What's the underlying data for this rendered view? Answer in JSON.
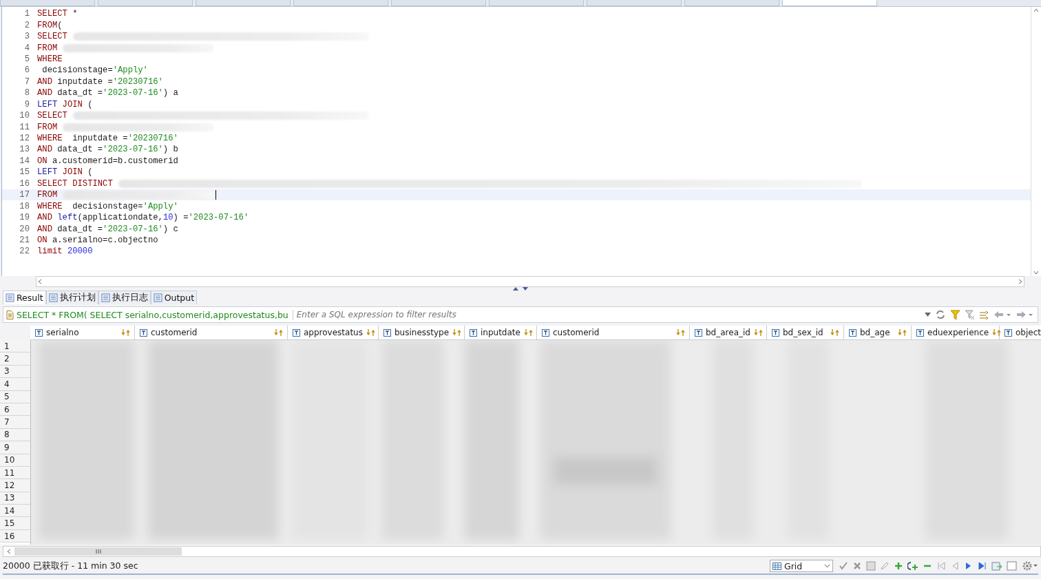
{
  "editor_tabs": [
    {
      "selected": false
    },
    {
      "selected": false
    },
    {
      "selected": false
    },
    {
      "selected": false
    },
    {
      "selected": false
    },
    {
      "selected": false
    },
    {
      "selected": false
    },
    {
      "selected": false
    },
    {
      "selected": true
    }
  ],
  "editor": {
    "lines": [
      {
        "number": "1",
        "current": false,
        "tokens": [
          {
            "kind": "kw",
            "text": "SELECT"
          },
          {
            "kind": "plain",
            "text": " *"
          }
        ]
      },
      {
        "number": "2",
        "current": false,
        "tokens": [
          {
            "kind": "kw",
            "text": "FROM"
          },
          {
            "kind": "plain",
            "text": "("
          }
        ]
      },
      {
        "number": "3",
        "current": false,
        "tokens": [
          {
            "kind": "kw",
            "text": "SELECT"
          }
        ],
        "kind": "masklong"
      },
      {
        "number": "4",
        "current": false,
        "tokens": [
          {
            "kind": "kw",
            "text": "FROM"
          }
        ],
        "kind": "maskshort"
      },
      {
        "number": "5",
        "current": false,
        "tokens": [
          {
            "kind": "kw",
            "text": "WHERE"
          }
        ]
      },
      {
        "number": "6",
        "current": false,
        "tokens": [
          {
            "kind": "plain",
            "text": " decisionstage="
          },
          {
            "kind": "str",
            "text": "'Apply'"
          }
        ]
      },
      {
        "number": "7",
        "current": false,
        "tokens": [
          {
            "kind": "kw",
            "text": "AND"
          },
          {
            "kind": "plain",
            "text": " inputdate ="
          },
          {
            "kind": "str",
            "text": "'20230716'"
          }
        ]
      },
      {
        "number": "8",
        "current": false,
        "tokens": [
          {
            "kind": "kw",
            "text": "AND"
          },
          {
            "kind": "plain",
            "text": " data_dt ="
          },
          {
            "kind": "str",
            "text": "'2023-07-16'"
          },
          {
            "kind": "plain",
            "text": ") a"
          }
        ]
      },
      {
        "number": "9",
        "current": false,
        "tokens": [
          {
            "kind": "fn",
            "text": "LEFT"
          },
          {
            "kind": "kw",
            "text": " JOIN"
          },
          {
            "kind": "plain",
            "text": " ("
          }
        ]
      },
      {
        "number": "10",
        "current": false,
        "tokens": [
          {
            "kind": "kw",
            "text": "SELECT"
          }
        ],
        "kind": "masklong"
      },
      {
        "number": "11",
        "current": false,
        "tokens": [
          {
            "kind": "kw",
            "text": "FROM"
          }
        ],
        "kind": "maskshort"
      },
      {
        "number": "12",
        "current": false,
        "tokens": [
          {
            "kind": "kw",
            "text": "WHERE"
          },
          {
            "kind": "plain",
            "text": "  inputdate ="
          },
          {
            "kind": "str",
            "text": "'20230716'"
          }
        ]
      },
      {
        "number": "13",
        "current": false,
        "tokens": [
          {
            "kind": "kw",
            "text": "AND"
          },
          {
            "kind": "plain",
            "text": " data_dt ="
          },
          {
            "kind": "str",
            "text": "'2023-07-16'"
          },
          {
            "kind": "plain",
            "text": ") b"
          }
        ]
      },
      {
        "number": "14",
        "current": false,
        "tokens": [
          {
            "kind": "kw",
            "text": "ON"
          },
          {
            "kind": "plain",
            "text": " a.customerid=b.customerid"
          }
        ]
      },
      {
        "number": "15",
        "current": false,
        "tokens": [
          {
            "kind": "fn",
            "text": "LEFT"
          },
          {
            "kind": "kw",
            "text": " JOIN"
          },
          {
            "kind": "plain",
            "text": " ("
          }
        ]
      },
      {
        "number": "16",
        "current": false,
        "tokens": [
          {
            "kind": "kw",
            "text": "SELECT DISTINCT"
          }
        ],
        "kind": "maskwide"
      },
      {
        "number": "17",
        "current": true,
        "tokens": [
          {
            "kind": "kw",
            "text": "FROM"
          }
        ],
        "kind": "maskshort"
      },
      {
        "number": "18",
        "current": false,
        "tokens": [
          {
            "kind": "kw",
            "text": "WHERE"
          },
          {
            "kind": "plain",
            "text": "  decisionstage="
          },
          {
            "kind": "str",
            "text": "'Apply'"
          }
        ]
      },
      {
        "number": "19",
        "current": false,
        "tokens": [
          {
            "kind": "kw",
            "text": "AND"
          },
          {
            "kind": "fn",
            "text": " left"
          },
          {
            "kind": "plain",
            "text": "(applicationdate,"
          },
          {
            "kind": "num",
            "text": "10"
          },
          {
            "kind": "plain",
            "text": ") ="
          },
          {
            "kind": "str",
            "text": "'2023-07-16'"
          }
        ]
      },
      {
        "number": "20",
        "current": false,
        "tokens": [
          {
            "kind": "kw",
            "text": "AND"
          },
          {
            "kind": "plain",
            "text": " data_dt ="
          },
          {
            "kind": "str",
            "text": "'2023-07-16'"
          },
          {
            "kind": "plain",
            "text": ") c"
          }
        ]
      },
      {
        "number": "21",
        "current": false,
        "tokens": [
          {
            "kind": "kw",
            "text": "ON"
          },
          {
            "kind": "plain",
            "text": " a.serialno=c.objectno"
          }
        ]
      },
      {
        "number": "22",
        "current": false,
        "tokens": [
          {
            "kind": "kw",
            "text": "limit"
          },
          {
            "kind": "num",
            "text": " 20000"
          }
        ]
      }
    ]
  },
  "result_tabs": [
    {
      "label": "Result",
      "selected": true
    },
    {
      "label": "执行计划",
      "selected": false
    },
    {
      "label": "执行日志",
      "selected": false
    },
    {
      "label": "Output",
      "selected": false
    }
  ],
  "filter": {
    "query": "SELECT * FROM( SELECT serialno,customerid,approvestatus,bu",
    "placeholder": "Enter a SQL expression to filter results"
  },
  "table": {
    "columns": [
      "serialno",
      "customerid",
      "approvestatus",
      "businesstype",
      "inputdate",
      "customerid",
      "bd_area_id",
      "bd_sex_id",
      "bd_age",
      "eduexperience",
      "object"
    ],
    "rows": [
      "1",
      "2",
      "3",
      "4",
      "5",
      "6",
      "7",
      "8",
      "9",
      "10",
      "11",
      "12",
      "13",
      "14",
      "15",
      "16"
    ]
  },
  "status_bar": {
    "text": "20000 已获取行 - 11 min 30 sec",
    "view": "Grid"
  }
}
